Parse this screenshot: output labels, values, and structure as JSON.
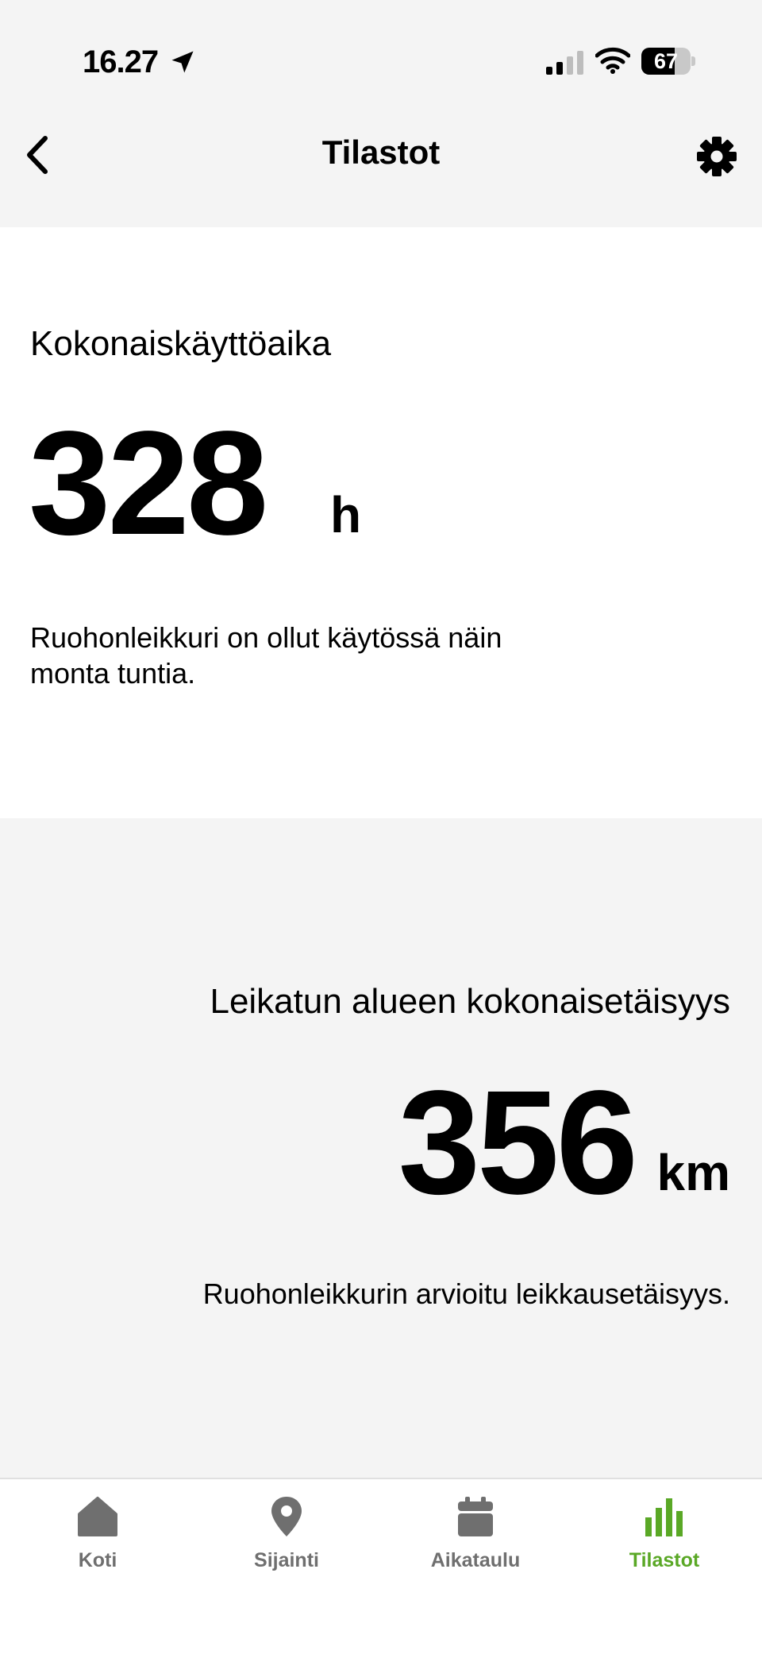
{
  "status_bar": {
    "time": "16.27",
    "battery_percent": "67",
    "battery_level": 0.67
  },
  "header": {
    "title": "Tilastot"
  },
  "stats": [
    {
      "label": "Kokonaiskäyttöaika",
      "value": "328",
      "unit": "h",
      "description": "Ruohonleikkuri on ollut käytössä näin monta tuntia."
    },
    {
      "label": "Leikatun alueen kokonaisetäisyys",
      "value": "356",
      "unit": "km",
      "description": "Ruohonleikkurin arvioitu leikkausetäisyys."
    }
  ],
  "tabs": [
    {
      "label": "Koti",
      "icon": "home-icon",
      "active": false
    },
    {
      "label": "Sijainti",
      "icon": "location-pin-icon",
      "active": false
    },
    {
      "label": "Aikataulu",
      "icon": "calendar-icon",
      "active": false
    },
    {
      "label": "Tilastot",
      "icon": "bar-chart-icon",
      "active": true
    }
  ],
  "colors": {
    "accent": "#5aa826",
    "inactive": "#6f6f6f",
    "background": "#f4f4f4",
    "card": "#ffffff"
  }
}
